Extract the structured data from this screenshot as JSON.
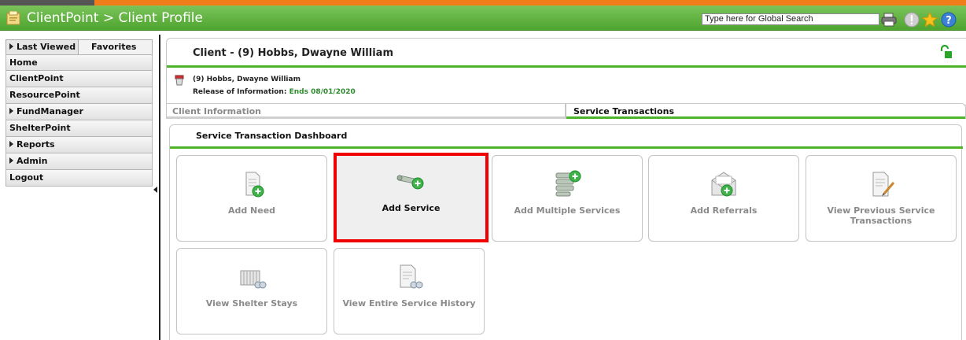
{
  "header": {
    "title": "ClientPoint > Client Profile",
    "search_value": "Type here for Global Search",
    "icons": [
      "printer-icon",
      "alert-icon",
      "favorite-star-icon",
      "help-icon"
    ],
    "accent_color": "#4fb42c"
  },
  "sidebar": {
    "tabs": {
      "last_viewed": "Last Viewed",
      "favorites": "Favorites"
    },
    "items": [
      {
        "label": "Home",
        "expandable": false
      },
      {
        "label": "ClientPoint",
        "expandable": false
      },
      {
        "label": "ResourcePoint",
        "expandable": false
      },
      {
        "label": "FundManager",
        "expandable": true
      },
      {
        "label": "ShelterPoint",
        "expandable": false
      },
      {
        "label": "Reports",
        "expandable": true
      },
      {
        "label": "Admin",
        "expandable": true
      },
      {
        "label": "Logout",
        "expandable": false
      }
    ]
  },
  "client": {
    "title": "Client - (9) Hobbs, Dwayne William",
    "name_line": "(9) Hobbs, Dwayne William",
    "roi_label": "Release of Information:",
    "roi_value": "Ends 08/01/2020"
  },
  "tabs": {
    "client_information": "Client Information",
    "service_transactions": "Service Transactions"
  },
  "dashboard": {
    "title": "Service Transaction Dashboard",
    "tiles": [
      {
        "label": "Add Need",
        "icon": "add-need-icon"
      },
      {
        "label": "Add Service",
        "icon": "add-service-icon",
        "selected": true
      },
      {
        "label": "Add Multiple Services",
        "icon": "add-multiple-services-icon"
      },
      {
        "label": "Add Referrals",
        "icon": "add-referrals-icon"
      },
      {
        "label": "View Previous Service Transactions",
        "icon": "view-previous-transactions-icon"
      },
      {
        "label": "View Shelter Stays",
        "icon": "view-shelter-stays-icon"
      },
      {
        "label": "View Entire Service History",
        "icon": "view-service-history-icon"
      }
    ]
  }
}
